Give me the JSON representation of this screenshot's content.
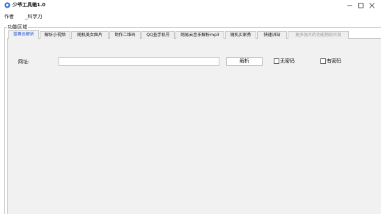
{
  "window": {
    "title": "少爷工具箱1.0",
    "app_icon": "blue-circle-logo-icon",
    "controls": [
      "minimize-icon",
      "maximize-icon",
      "close-icon"
    ]
  },
  "menu": {
    "author_label": "作者",
    "tech_label": "_科学刀"
  },
  "group": {
    "label": "功能区域"
  },
  "tabs": [
    {
      "label": "蓝奏云解析",
      "active": true
    },
    {
      "label": "解析小视频"
    },
    {
      "label": "随机美女图片"
    },
    {
      "label": "制作二维码"
    },
    {
      "label": "QQ查手机号"
    },
    {
      "label": "网易云音乐解析mp3"
    },
    {
      "label": "随机买家秀"
    },
    {
      "label": "快速识站"
    },
    {
      "label": "更多强大的功能稍后开发",
      "disabled": true
    }
  ],
  "form": {
    "url_label": "网址:",
    "url_value": "",
    "parse_button": "解析",
    "no_password_label": "无密码",
    "has_password_label": "有密码"
  },
  "colors": {
    "active_tab_text": "#1f4fd1",
    "panel_background": "#f1f1f1",
    "disabled_tab_text": "#9a9a9a"
  }
}
